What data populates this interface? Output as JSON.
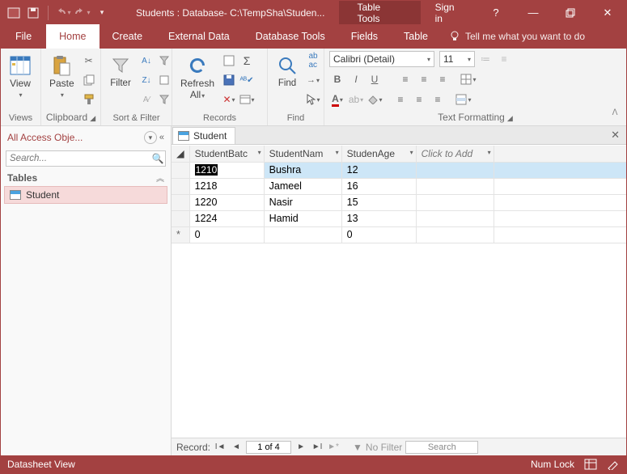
{
  "titlebar": {
    "title": "Students : Database- C:\\TempSha\\Studen...",
    "contextTab": "Table Tools",
    "signIn": "Sign in"
  },
  "ribbonTabs": {
    "file": "File",
    "home": "Home",
    "create": "Create",
    "externalData": "External Data",
    "databaseTools": "Database Tools",
    "fields": "Fields",
    "table": "Table",
    "tellMe": "Tell me what you want to do"
  },
  "ribbonGroups": {
    "views": "Views",
    "clipboard": "Clipboard",
    "sortFilter": "Sort & Filter",
    "records": "Records",
    "find": "Find",
    "textFormatting": "Text Formatting"
  },
  "ribbonButtons": {
    "view": "View",
    "paste": "Paste",
    "filter": "Filter",
    "refreshAll": "Refresh\nAll",
    "find": "Find"
  },
  "font": {
    "name": "Calibri (Detail)",
    "size": "11"
  },
  "nav": {
    "title": "All Access Obje...",
    "searchPlaceholder": "Search...",
    "groupTables": "Tables",
    "itemStudent": "Student"
  },
  "docTab": {
    "name": "Student"
  },
  "columns": {
    "batch": "StudentBatc",
    "name": "StudentNam",
    "age": "StudenAge",
    "clickToAdd": "Click to Add"
  },
  "rows": [
    {
      "batch": "1210",
      "name": "Bushra",
      "age": "12"
    },
    {
      "batch": "1218",
      "name": "Jameel",
      "age": "16"
    },
    {
      "batch": "1220",
      "name": "Nasir",
      "age": "15"
    },
    {
      "batch": "1224",
      "name": "Hamid",
      "age": "13"
    }
  ],
  "newRow": {
    "batch": "0",
    "age": "0"
  },
  "recordNav": {
    "label": "Record:",
    "position": "1 of 4",
    "noFilter": "No Filter",
    "search": "Search"
  },
  "status": {
    "view": "Datasheet View",
    "numlock": "Num Lock"
  }
}
